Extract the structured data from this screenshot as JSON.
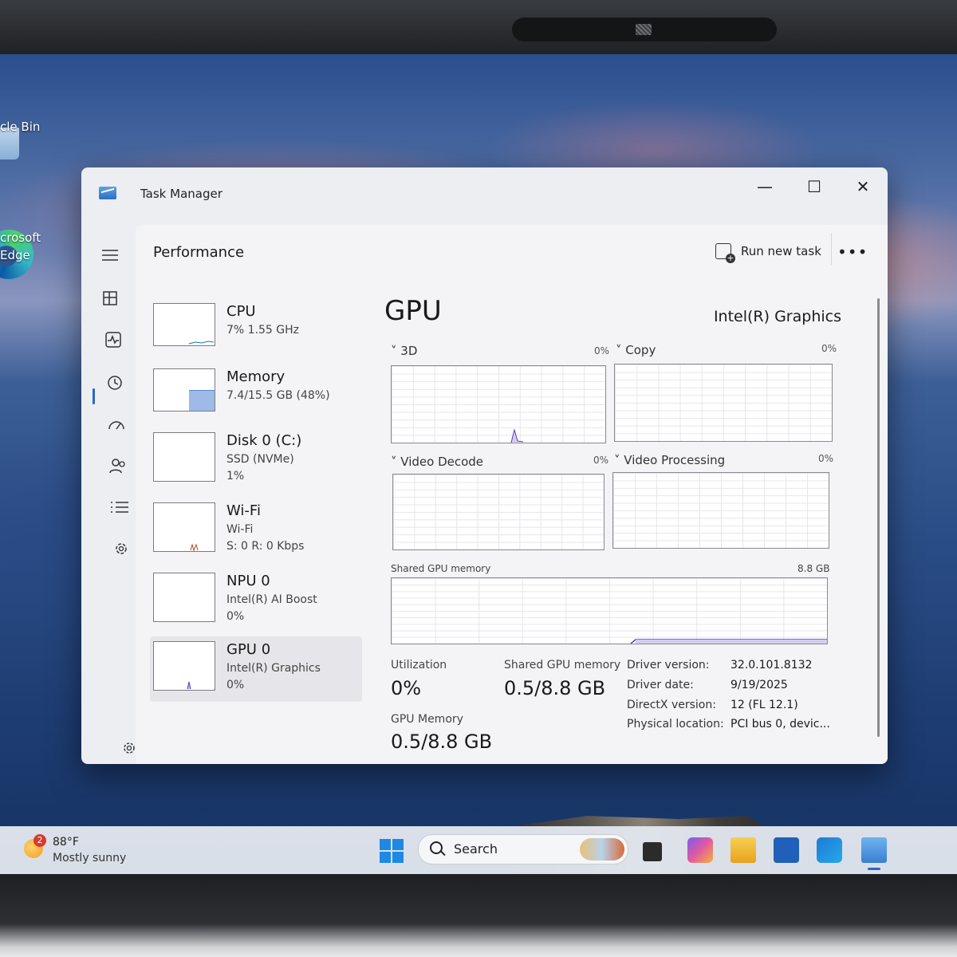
{
  "desktop": {
    "icons": [
      {
        "label": "cle Bin"
      },
      {
        "label": "crosoft",
        "label2": "Edge"
      }
    ]
  },
  "window": {
    "title": "Task Manager",
    "min": "—",
    "max": "☐",
    "close": "✕"
  },
  "nav_icons": [
    "hamburger-icon",
    "processes-icon",
    "performance-icon",
    "app-history-icon",
    "startup-apps-icon",
    "users-icon",
    "details-icon",
    "services-icon",
    "settings-icon"
  ],
  "header": {
    "title": "Performance",
    "run_new_task": "Run new task",
    "more": "•••"
  },
  "devices": [
    {
      "name": "CPU",
      "line1": "7%  1.55 GHz",
      "line2": "",
      "thumb_color": "#1a6fb5"
    },
    {
      "name": "Memory",
      "line1": "7.4/15.5 GB (48%)",
      "line2": "",
      "thumb_color": "#8a3fb5",
      "fill": 0.48
    },
    {
      "name": "Disk 0 (C:)",
      "line1": "SSD (NVMe)",
      "line2": "1%",
      "thumb_color": "#2f8a2f"
    },
    {
      "name": "Wi-Fi",
      "line1": "Wi-Fi",
      "line2": "S: 0  R: 0 Kbps",
      "thumb_color": "#b34a2a"
    },
    {
      "name": "NPU 0",
      "line1": "Intel(R) AI Boost",
      "line2": "0%",
      "thumb_color": "#2aa0b3"
    },
    {
      "name": "GPU 0",
      "line1": "Intel(R) Graphics",
      "line2": "0%",
      "thumb_color": "#5b3ab5"
    }
  ],
  "gpu": {
    "title": "GPU",
    "model": "Intel(R) Graphics",
    "engines": [
      {
        "name": "3D",
        "pct": "0%"
      },
      {
        "name": "Copy",
        "pct": "0%"
      },
      {
        "name": "Video Decode",
        "pct": "0%"
      },
      {
        "name": "Video Processing",
        "pct": "0%"
      }
    ],
    "shared_label": "Shared GPU memory",
    "shared_max": "8.8 GB",
    "chevron": "˅",
    "stats": {
      "utilization_label": "Utilization",
      "utilization_value": "0%",
      "shared_label": "Shared GPU memory",
      "shared_value": "0.5/8.8 GB",
      "gpu_memory_label": "GPU Memory",
      "gpu_memory_value": "0.5/8.8 GB"
    },
    "details": [
      {
        "key": "Driver version:",
        "value": "32.0.101.8132"
      },
      {
        "key": "Driver date:",
        "value": "9/19/2025"
      },
      {
        "key": "DirectX version:",
        "value": "12 (FL 12.1)"
      },
      {
        "key": "Physical location:",
        "value": "PCI bus 0, devic..."
      }
    ]
  },
  "taskbar": {
    "weather_badge": "2",
    "weather_temp": "88°F",
    "weather_desc": "Mostly sunny",
    "search_text": "Search",
    "apps": [
      "task-view-icon",
      "m365-copilot-icon",
      "file-explorer-icon",
      "microsoft-store-icon",
      "outlook-icon",
      "task-manager-icon"
    ],
    "app_colors": [
      "#2b2b2b",
      "#c54fb0",
      "#f2b632",
      "#2060b8",
      "#1d7ad6",
      "#3a7fd0"
    ]
  }
}
